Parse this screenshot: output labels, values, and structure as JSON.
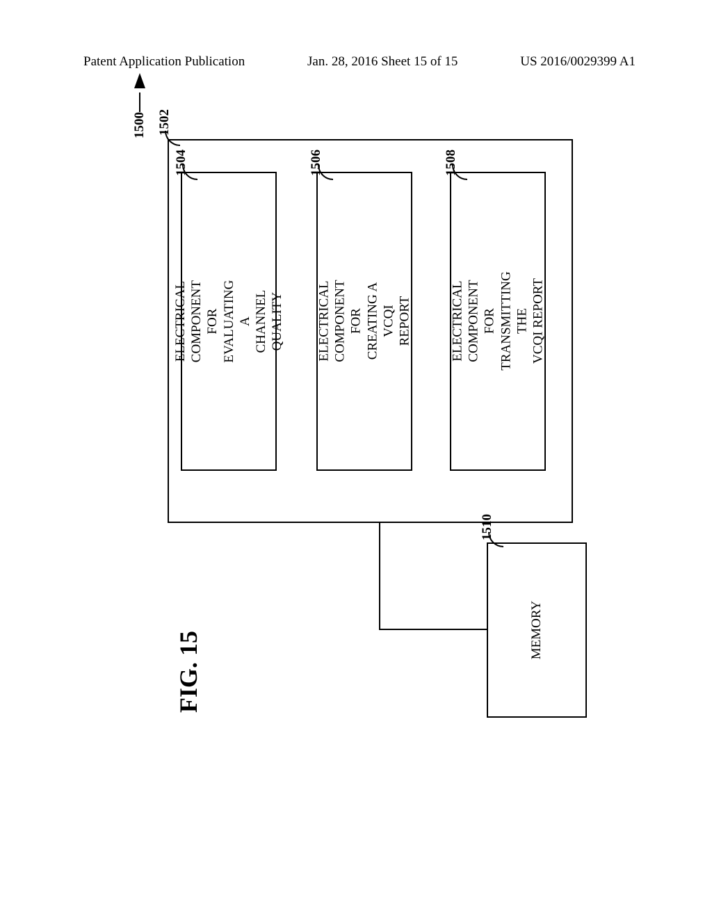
{
  "header": {
    "left": "Patent Application Publication",
    "center": "Jan. 28, 2016  Sheet 15 of 15",
    "right": "US 2016/0029399 A1"
  },
  "figure": {
    "system_ref": "1500",
    "container_ref": "1502",
    "components": [
      {
        "ref": "1504",
        "text": "ELECTRICAL\nCOMPONENT FOR\nEVALUATING A\nCHANNEL QUALITY"
      },
      {
        "ref": "1506",
        "text": "ELECTRICAL\nCOMPONENT FOR\nCREATING A VCQI\nREPORT"
      },
      {
        "ref": "1508",
        "text": "ELECTRICAL\nCOMPONENT FOR\nTRANSMITTING THE\nVCQI REPORT"
      }
    ],
    "memory": {
      "ref": "1510",
      "text": "MEMORY"
    },
    "caption": "FIG. 15"
  }
}
